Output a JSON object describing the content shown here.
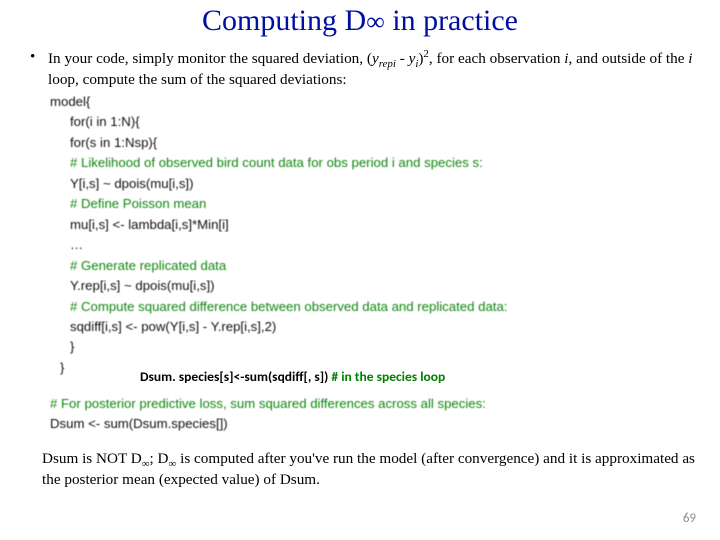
{
  "title": {
    "pre": "Computing D",
    "inf": "∞",
    "post": " in practice"
  },
  "bullet": {
    "dot": "•",
    "t1": "In your code, simply monitor the squared deviation, (",
    "y": "y",
    "repi": "repi",
    "t2": " - ",
    "yi_y": "y",
    "yi_i": "i",
    "t3": ")",
    "sq": "2",
    "t4": ", for each observation ",
    "i_obs": "i",
    "t5": ", and outside of the ",
    "i_loop": "i",
    "t6": " loop, compute the sum of the squared deviations:"
  },
  "code": {
    "l0": "model{",
    "l1": "for(i in 1:N){",
    "l2": "for(s in 1:Nsp){",
    "c1": "# Likelihood of observed bird count data for obs period i and species s:",
    "l3": "Y[i,s] ~ dpois(mu[i,s])",
    "c2": "# Define Poisson mean",
    "l4": "mu[i,s] <- lambda[i,s]*Min[i]",
    "dots": "…",
    "c3": "# Generate replicated data",
    "l5": "Y.rep[i,s] ~ dpois(mu[i,s])",
    "c4": "# Compute squared difference between observed data and replicated data:",
    "l6": "sqdiff[i,s] <- pow(Y[i,s] - Y.rep[i,s],2)",
    "l7": "}",
    "l8": "}"
  },
  "dsum_species": {
    "main": "Dsum. species[s]<-sum(sqdiff[, s])  ",
    "comment": "# in the species loop"
  },
  "lower": {
    "c": "# For posterior predictive loss, sum squared differences across all species:",
    "l": "Dsum <- sum(Dsum.species[])"
  },
  "closing": {
    "p1": "Dsum is NOT D",
    "inf1": "∞",
    "p2": "; D",
    "inf2": "∞",
    "p3": " is computed after you've run the model (after convergence) and it is approximated as the posterior mean (expected value) of Dsum."
  },
  "pagenum": "69"
}
